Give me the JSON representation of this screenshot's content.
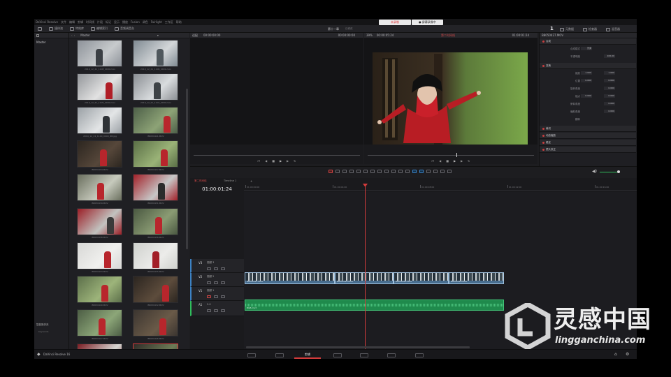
{
  "menubar": {
    "items": [
      "DaVinci Resolve",
      "文件",
      "编辑",
      "剪辑",
      "时间线",
      "片段",
      "标记",
      "显示",
      "播放",
      "Fusion",
      "调色",
      "Fairlight",
      "工作区",
      "帮助"
    ],
    "rec_label": "未录制",
    "rec_status": "● 屏幕录像中"
  },
  "toolbar": {
    "left": [
      "媒体池",
      "特效库",
      "编辑索引",
      "音频调音台"
    ],
    "project_name": "第十一章",
    "project_status": "已修改",
    "right": [
      "元数据",
      "检查器",
      "混音器"
    ],
    "page_number": "1"
  },
  "media_pool": {
    "root_bin": "Master",
    "header": "Master",
    "thumb_labels": [
      "2019_12_21_1108_0000.mov",
      "2019_12_21_1106_0001.mov",
      "2019_12_21_1105_0000.mov",
      "2019_12_21_1101_0000.mov",
      "2019_12_21_1100_0000_RB.jpg",
      "B8050441.MOV",
      "B8050434.MOV",
      "B8050437.MOV",
      "B8050439.MOV",
      "B8050431.MOV",
      "B8050438.MOV",
      "B8050436.MOV",
      "B8050433.MOV",
      "B8050435.MOV",
      "B8050440.MOV",
      "B8050432.MOV",
      "B8050427.MOV",
      "B8050426.MOV",
      "B8050425.MOV",
      "B8050418.MOV"
    ],
    "smart_bins": "智能媒体夹",
    "smart_bin_item": "Keywords"
  },
  "source_viewer": {
    "zoom": "适配",
    "timecode_left": "00:00:00:00",
    "timecode_right": "00:00:00:00"
  },
  "timeline_viewer": {
    "zoom": "39%",
    "timecode": "00:00:05:24",
    "timeline_name": "第二时间线",
    "timecode_right": "01:00:01:24",
    "clip_name": "B8050427.MOV"
  },
  "timeline": {
    "tab_name": "第二时间线",
    "tab2": "Timeline 1",
    "timecode": "01:00:01:24",
    "ruler": [
      "01:00:00:00",
      "01:00:04:00",
      "01:00:08:00",
      "01:00:12:00",
      "01:00:16:00"
    ],
    "tracks": [
      {
        "id": "V3",
        "name": "视频 3"
      },
      {
        "id": "V2",
        "name": "视频 2"
      },
      {
        "id": "V1",
        "name": "视频 1"
      },
      {
        "id": "A1",
        "name": "",
        "level": "2.0"
      }
    ],
    "video_clips": [
      "B8050427.MOV",
      "B8050424.MOV",
      "B8050425.MOV",
      "B8050418.MOV"
    ],
    "audio_clip": "BGB.mp3"
  },
  "inspector": {
    "clip_name": "B8050427.MOV",
    "sections": [
      {
        "title": "合成"
      },
      {
        "title": "变换"
      },
      {
        "title": "裁切"
      },
      {
        "title": "动态缩放"
      },
      {
        "title": "稳定"
      },
      {
        "title": "镜头校正"
      }
    ],
    "composite_rows": [
      {
        "label": "合成模式",
        "v1": "普通",
        "v2": ""
      },
      {
        "label": "不透明度",
        "v1": "",
        "v2": "100.00"
      }
    ],
    "transform_rows": [
      {
        "label": "缩放",
        "v1": "1.000",
        "v2": "1.000"
      },
      {
        "label": "位置",
        "v1": "0.000",
        "v2": "0.000"
      },
      {
        "label": "旋转角度",
        "v1": "",
        "v2": "0.000"
      },
      {
        "label": "锚点",
        "v1": "0.000",
        "v2": "0.000"
      },
      {
        "label": "俯仰角度",
        "v1": "",
        "v2": "0.000"
      },
      {
        "label": "偏航角度",
        "v1": "",
        "v2": "0.000"
      },
      {
        "label": "翻转",
        "v1": "",
        "v2": ""
      }
    ]
  },
  "bottom_bar": {
    "app_name": "DaVinci Resolve 16",
    "active_page": "剪辑"
  },
  "watermark": {
    "brand": "灵感中国",
    "url": "lingganchina.com"
  }
}
